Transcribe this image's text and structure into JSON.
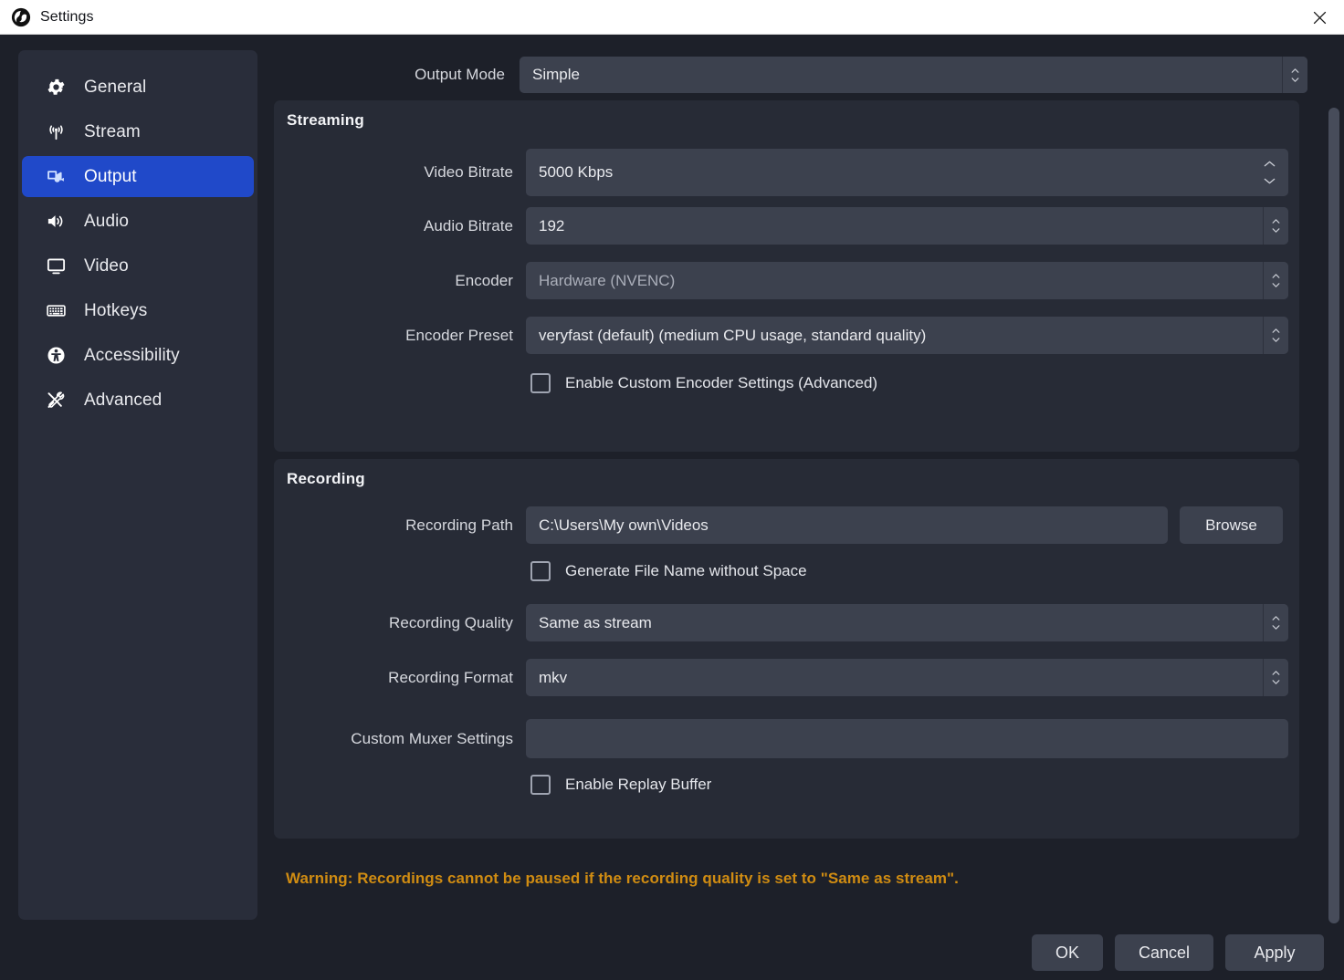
{
  "window": {
    "title": "Settings",
    "logo_icon": "obs-logo-icon",
    "close_icon": "close-icon"
  },
  "sidebar": {
    "items": [
      {
        "label": "General",
        "icon": "gear-icon",
        "selected": false
      },
      {
        "label": "Stream",
        "icon": "broadcast-icon",
        "selected": false
      },
      {
        "label": "Output",
        "icon": "video-camera-icon",
        "selected": true
      },
      {
        "label": "Audio",
        "icon": "speaker-icon",
        "selected": false
      },
      {
        "label": "Video",
        "icon": "monitor-icon",
        "selected": false
      },
      {
        "label": "Hotkeys",
        "icon": "keyboard-icon",
        "selected": false
      },
      {
        "label": "Accessibility",
        "icon": "accessibility-icon",
        "selected": false
      },
      {
        "label": "Advanced",
        "icon": "tools-icon",
        "selected": false
      }
    ]
  },
  "output_mode": {
    "label": "Output Mode",
    "value": "Simple"
  },
  "streaming": {
    "title": "Streaming",
    "video_bitrate": {
      "label": "Video Bitrate",
      "value": "5000 Kbps"
    },
    "audio_bitrate": {
      "label": "Audio Bitrate",
      "value": "192"
    },
    "encoder": {
      "label": "Encoder",
      "value": "Hardware (NVENC)"
    },
    "encoder_preset": {
      "label": "Encoder Preset",
      "value": "veryfast (default) (medium CPU usage, standard quality)"
    },
    "custom_encoder_checkbox": {
      "label": "Enable Custom Encoder Settings (Advanced)",
      "checked": false
    }
  },
  "recording": {
    "title": "Recording",
    "recording_path": {
      "label": "Recording Path",
      "value": "C:\\Users\\My own\\Videos",
      "browse_label": "Browse"
    },
    "generate_filename_checkbox": {
      "label": "Generate File Name without Space",
      "checked": false
    },
    "recording_quality": {
      "label": "Recording Quality",
      "value": "Same as stream"
    },
    "recording_format": {
      "label": "Recording Format",
      "value": "mkv"
    },
    "custom_muxer": {
      "label": "Custom Muxer Settings",
      "value": "",
      "placeholder": ""
    },
    "replay_buffer_checkbox": {
      "label": "Enable Replay Buffer",
      "checked": false
    }
  },
  "warning": {
    "text": "Warning: Recordings cannot be paused if the recording quality is set to \"Same as stream\"."
  },
  "footer": {
    "ok": "OK",
    "cancel": "Cancel",
    "apply": "Apply"
  },
  "colors": {
    "accent_selected": "#2049c9",
    "warning": "#d08c12",
    "window_bg": "#1d2029",
    "panel_bg": "#272b36",
    "field_bg": "#3c414e"
  }
}
